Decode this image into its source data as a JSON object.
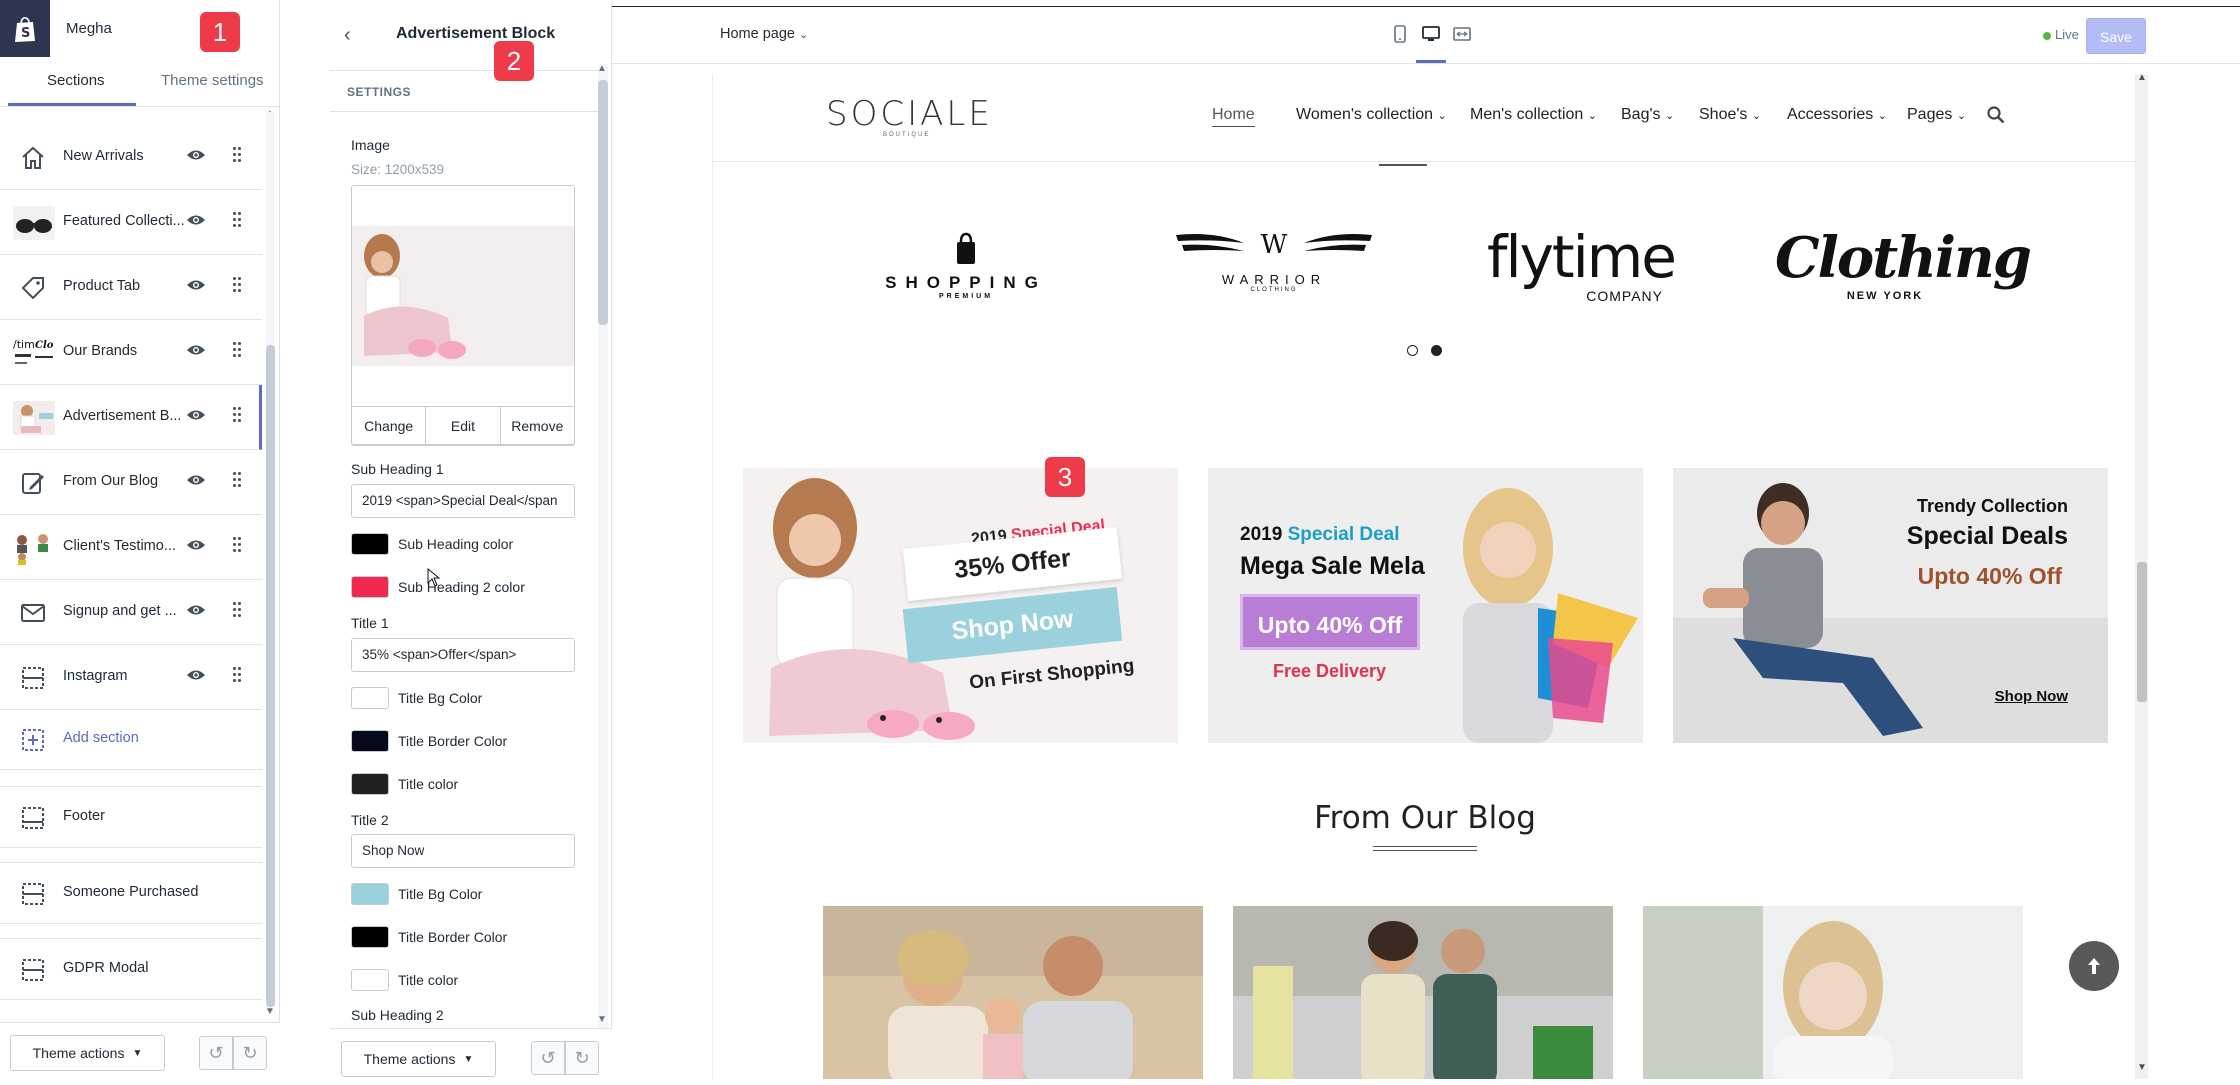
{
  "store": {
    "name": "Megha"
  },
  "sidebar": {
    "tabs": [
      {
        "label": "Sections"
      },
      {
        "label": "Theme settings"
      }
    ],
    "sections": [
      {
        "label": "New Arrivals",
        "icon": "home-icon"
      },
      {
        "label": "Featured Collecti...",
        "icon": "sunglasses-thumbnail"
      },
      {
        "label": "Product Tab",
        "icon": "tag-icon"
      },
      {
        "label": "Our Brands",
        "icon": "brands-thumbnail"
      },
      {
        "label": "Advertisement B...",
        "icon": "advertisement-thumbnail"
      },
      {
        "label": "From Our Blog",
        "icon": "edit-icon"
      },
      {
        "label": "Client's Testimo...",
        "icon": "testimonials-thumbnail"
      },
      {
        "label": "Signup and get ...",
        "icon": "mail-icon"
      },
      {
        "label": "Instagram",
        "icon": "layout-icon"
      }
    ],
    "add_section": "Add section",
    "fixed_sections": [
      {
        "label": "Footer"
      },
      {
        "label": "Someone Purchased"
      },
      {
        "label": "GDPR Modal"
      }
    ],
    "theme_actions": "Theme actions"
  },
  "settings_panel": {
    "title": "Advertisement Block",
    "header": "SETTINGS",
    "image_label": "Image",
    "image_size": "Size: 1200x539",
    "image_actions": [
      "Change",
      "Edit",
      "Remove"
    ],
    "sub_heading_1_label": "Sub Heading 1",
    "sub_heading_1_value": "2019 <span>Special Deal</span",
    "colors_group_1": [
      {
        "label": "Sub Heading color",
        "color": "#000000"
      },
      {
        "label": "Sub Heading 2 color",
        "color": "#ee2b4f"
      }
    ],
    "title_1_label": "Title 1",
    "title_1_value": "35%  <span>Offer</span>",
    "colors_group_2": [
      {
        "label": "Title Bg Color",
        "color": "#ffffff"
      },
      {
        "label": "Title Border Color",
        "color": "#06091a"
      },
      {
        "label": "Title color",
        "color": "#231f20"
      }
    ],
    "title_2_label": "Title 2",
    "title_2_value": "Shop Now",
    "colors_group_3": [
      {
        "label": "Title Bg Color",
        "color": "#9bd0dd"
      },
      {
        "label": "Title Border Color",
        "color": "#000000"
      },
      {
        "label": "Title color",
        "color": "#ffffff"
      }
    ],
    "sub_heading_2_label": "Sub Heading 2",
    "theme_actions": "Theme actions"
  },
  "topbar": {
    "page_selector": "Home page",
    "live": "Live",
    "save": "Save"
  },
  "markers": [
    "1",
    "2",
    "3"
  ],
  "preview": {
    "brand": "SOCIALE",
    "brand_sub": "BOUTIQUE",
    "nav": [
      "Home",
      "Women's collection",
      "Men's collection",
      "Bag's",
      "Shoe's",
      "Accessories",
      "Pages"
    ],
    "brands": [
      {
        "name": "SHOPPING",
        "sub": "PREMIUM"
      },
      {
        "name": "WARRIOR",
        "sub": "CLOTHING"
      },
      {
        "name": "flytime",
        "sub": "COMPANY"
      },
      {
        "name": "Clothing",
        "sub": "NEW YORK"
      }
    ],
    "banner_1": {
      "sub": "2019",
      "sub_highlight": "Special Deal",
      "title": "35% Offer",
      "button": "Shop Now",
      "footer": "On First Shopping"
    },
    "banner_2": {
      "sub": "2019",
      "sub_highlight": "Special Deal",
      "title": "Mega Sale Mela",
      "offer": "Upto 40% Off",
      "footer": "Free Delivery"
    },
    "banner_3": {
      "sub": "Trendy Collection",
      "title": "Special Deals",
      "offer": "Upto 40% Off",
      "link": "Shop Now"
    },
    "blog_title": "From Our Blog"
  },
  "colors": {
    "accent": "#5c6ac4",
    "marker": "#ed3b4a",
    "shopify_dark": "#2d3550"
  }
}
